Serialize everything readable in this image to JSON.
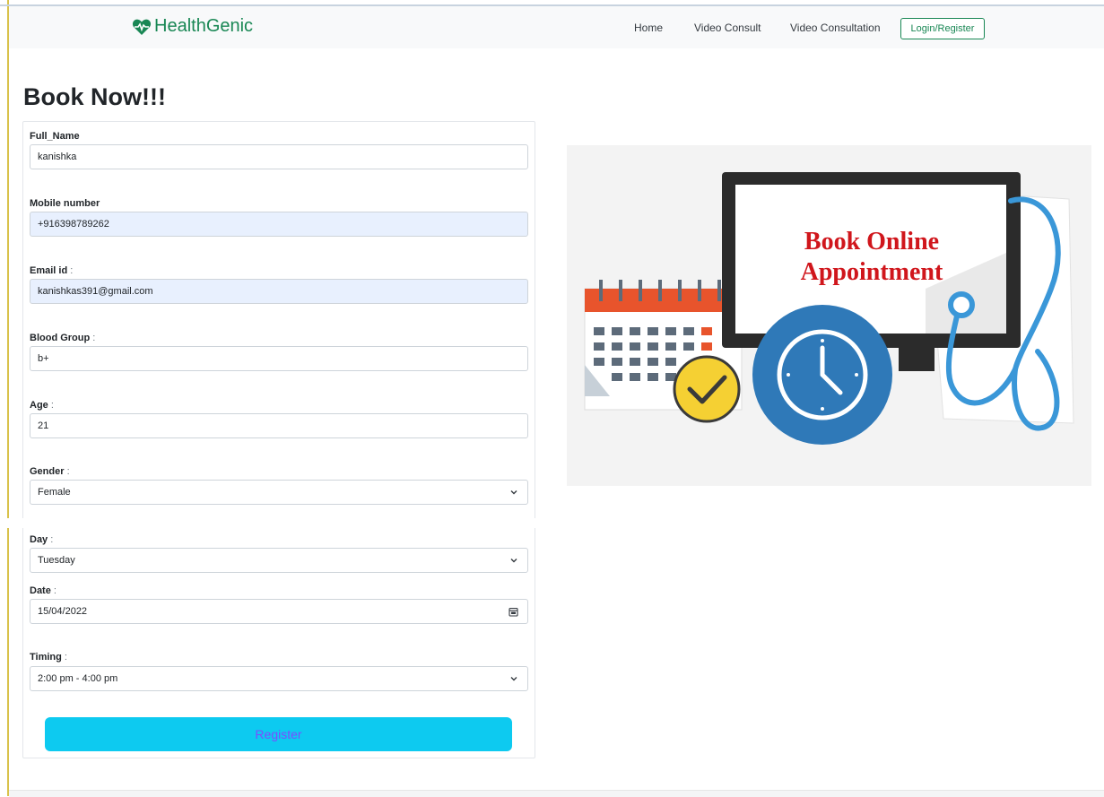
{
  "nav": {
    "brand": "HealthGenic",
    "links": [
      "Home",
      "Video Consult",
      "Video Consultation"
    ],
    "login": "Login/Register"
  },
  "page_title": "Book Now!!!",
  "form": {
    "full_name": {
      "label": "Full_Name",
      "suffix": "",
      "value": "kanishka"
    },
    "mobile": {
      "label": "Mobile number",
      "suffix": "",
      "value": "+916398789262"
    },
    "email": {
      "label": "Email id",
      "suffix": " :",
      "value": "kanishkas391@gmail.com"
    },
    "blood_group": {
      "label": "Blood Group",
      "suffix": " :",
      "value": "b+"
    },
    "age": {
      "label": "Age",
      "suffix": " :",
      "value": "21"
    },
    "gender": {
      "label": "Gender",
      "suffix": " :",
      "value": "Female"
    },
    "day": {
      "label": "Day",
      "suffix": " :",
      "value": "Tuesday"
    },
    "date": {
      "label": "Date",
      "suffix": " :",
      "value": "15/04/2022"
    },
    "timing": {
      "label": "Timing",
      "suffix": " :",
      "value": "2:00 pm - 4:00 pm"
    },
    "submit": "Register"
  },
  "hero": {
    "line1": "Book Online",
    "line2": "Appointment"
  },
  "colors": {
    "brand": "#198754",
    "button": "#0dcaf0",
    "button_text": "#7c4dff",
    "hero_text": "#d0161c"
  }
}
